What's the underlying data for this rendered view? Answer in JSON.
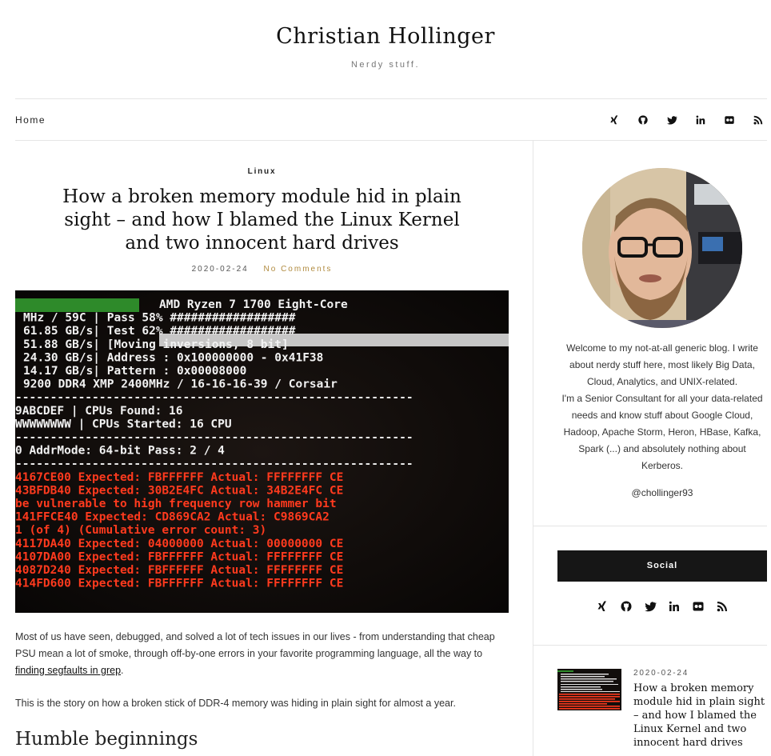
{
  "site": {
    "title": "Christian Hollinger",
    "tagline": "Nerdy stuff."
  },
  "nav": {
    "home_label": "Home",
    "icons": [
      "xing-icon",
      "github-icon",
      "twitter-icon",
      "linkedin-icon",
      "flickr-icon",
      "rss-icon"
    ]
  },
  "post": {
    "category": "Linux",
    "title": "How a broken memory module hid in plain sight – and how I blamed the Linux Kernel and two innocent hard drives",
    "date": "2020-02-24",
    "comments": "No Comments",
    "image": {
      "lines": [
        {
          "text": "AMD Ryzen 7 1700 Eight-Core",
          "color": "#f2f2f2"
        },
        {
          "text": "MHz / 59C      |  Pass      58%  ##################",
          "color": "#f2f2f2"
        },
        {
          "text": "  61.85 GB/s|  Test      62%  ##################",
          "color": "#f2f2f2"
        },
        {
          "text": "  51.88 GB/s|  [Moving inversions, 8 bit]",
          "color": "#f2f2f2"
        },
        {
          "text": "  24.30 GB/s| Address    : 0x100000000 - 0x41F38",
          "color": "#f2f2f2"
        },
        {
          "text": "  14.17 GB/s| Pattern    : 0x00008000",
          "color": "#f2f2f2"
        },
        {
          "text": "9200 DDR4 XMP 2400MHz / 16-16-16-39 / Corsair",
          "color": "#f2f2f2"
        },
        {
          "text": "---------------------------------------------------------",
          "color": "#e8e8e8"
        },
        {
          "text": "9ABCDEF                 |  CPUs Found:      16",
          "color": "#f2f2f2"
        },
        {
          "text": "WWWWWWWW                |  CPUs Started:    16 CPU",
          "color": "#f2f2f2"
        },
        {
          "text": "---------------------------------------------------------",
          "color": "#e8e8e8"
        },
        {
          "text": "0     AddrMode: 64-bit          Pass: 2 / 4",
          "color": "#f2f2f2"
        },
        {
          "text": "---------------------------------------------------------",
          "color": "#e8e8e8"
        },
        {
          "text": "4167CE00 Expected: FBFFFFFF  Actual: FFFFFFFF  CE",
          "color": "#ff3a1e"
        },
        {
          "text": "43BFDB40 Expected: 30B2E4FC  Actual: 34B2E4FC  CE",
          "color": "#ff3a1e"
        },
        {
          "text": "be vulnerable to high frequency row hammer bit",
          "color": "#ff3a1e"
        },
        {
          "text": "141FFCE40 Expected: CD869CA2  Actual: C9869CA2",
          "color": "#ff3a1e"
        },
        {
          "text": "1 (of 4) (Cumulative error count: 3)",
          "color": "#ff3a1e"
        },
        {
          "text": "4117DA40 Expected: 04000000  Actual: 00000000  CE",
          "color": "#ff3a1e"
        },
        {
          "text": "4107DA00 Expected: FBFFFFFF  Actual: FFFFFFFF  CE",
          "color": "#ff3a1e"
        },
        {
          "text": "4087D240 Expected: FBFFFFFF  Actual: FFFFFFFF  CE",
          "color": "#ff3a1e"
        },
        {
          "text": "414FD600 Expected: FBFFFFFF  Actual: FFFFFFFF  CE",
          "color": "#ff3a1e"
        }
      ]
    },
    "para1_text": "Most of us have seen, debugged, and solved a lot of tech issues in our lives - from understanding that cheap PSU mean a lot of smoke, through off-by-one errors in your favorite programming language, all the way to ",
    "para1_link": "finding segfaults in grep",
    "para1_end": ".",
    "para2": "This is the story on how a broken stick of DDR-4 memory was hiding in plain sight for almost a year.",
    "heading": "Humble beginnings"
  },
  "sidebar": {
    "bio_line1": "Welcome to my not-at-all generic blog. I write about nerdy stuff here, most likely Big Data, Cloud, Analytics, and UNIX-related.",
    "bio_line2": "I'm a Senior Consultant for all your data-related needs and know stuff about Google Cloud, Hadoop, Apache Storm, Heron, HBase, Kafka, Spark (...) and absolutely nothing about Kerberos.",
    "handle": "@chollinger93",
    "social_title": "Social",
    "recent": {
      "date": "2020-02-24",
      "title": "How a broken memory module hid in plain sight – and how I blamed the Linux Kernel and two innocent hard drives"
    }
  },
  "colors": {
    "accent": "#b08a3e",
    "dark_bar": "#161616",
    "border": "#e5e5e5"
  }
}
